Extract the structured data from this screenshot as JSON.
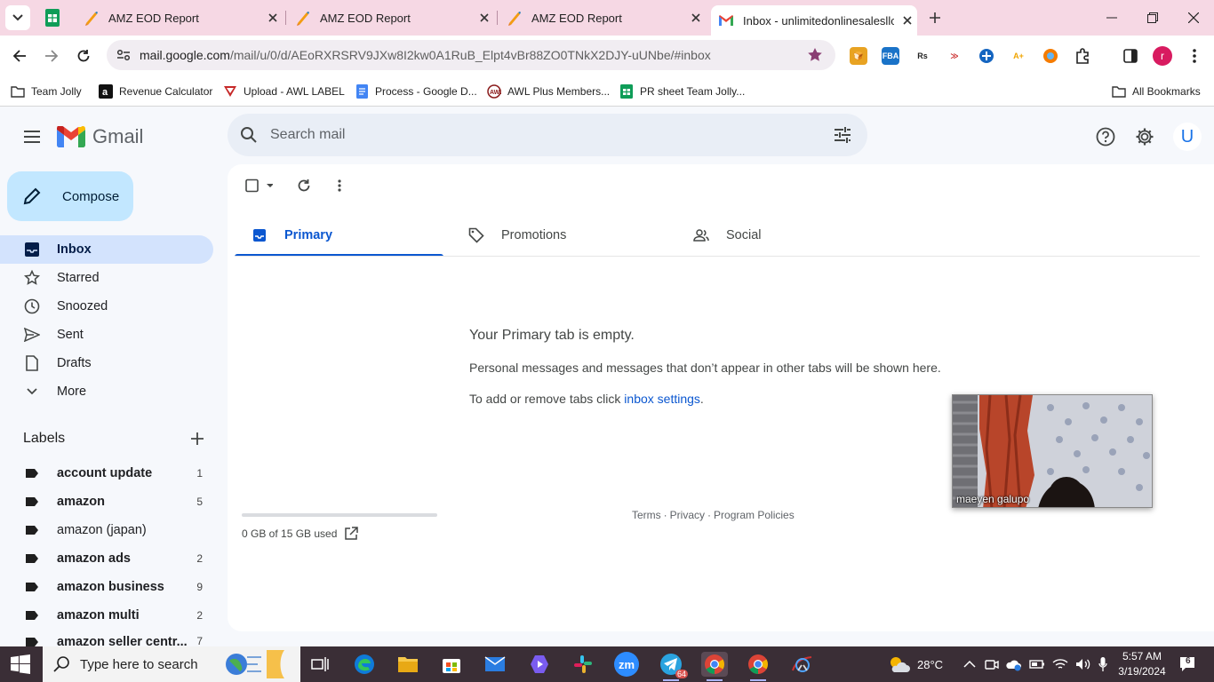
{
  "browser": {
    "tabs": [
      {
        "title": "AMZ EOD Report"
      },
      {
        "title": "AMZ EOD Report"
      },
      {
        "title": "AMZ EOD Report"
      },
      {
        "title": "Inbox - unlimitedonlinesalesllc@gmail.com - Gmail",
        "active": true
      }
    ],
    "url_host": "mail.google.com",
    "url_path": "/mail/u/0/d/AEoRXRSRV9JXw8I2kw0A1RuB_Elpt4vBr88ZO0TNkX2DJY-uUNbe/#inbox",
    "profile_initial": "r",
    "bookmarks": [
      {
        "label": "Team Jolly",
        "icon": "folder-icon"
      },
      {
        "label": "Revenue Calculator",
        "icon": "amazon-icon"
      },
      {
        "label": "Upload - AWL LABEL",
        "icon": "awl-icon"
      },
      {
        "label": "Process - Google D...",
        "icon": "docs-icon"
      },
      {
        "label": "AWL Plus Members...",
        "icon": "awl-plus-icon"
      },
      {
        "label": "PR sheet Team Jolly...",
        "icon": "sheets-icon"
      }
    ],
    "all_bookmarks_label": "All Bookmarks"
  },
  "gmail": {
    "logo_text": "Gmail",
    "search_placeholder": "Search mail",
    "avatar_initial": "U",
    "compose_label": "Compose",
    "nav": [
      {
        "label": "Inbox",
        "icon": "inbox-icon",
        "active": true
      },
      {
        "label": "Starred",
        "icon": "star-icon"
      },
      {
        "label": "Snoozed",
        "icon": "clock-icon"
      },
      {
        "label": "Sent",
        "icon": "send-icon"
      },
      {
        "label": "Drafts",
        "icon": "draft-icon"
      },
      {
        "label": "More",
        "icon": "chevron-down-icon"
      }
    ],
    "labels_heading": "Labels",
    "labels": [
      {
        "name": "account update",
        "count": "1",
        "bold": true
      },
      {
        "name": "amazon",
        "count": "5",
        "bold": true
      },
      {
        "name": "amazon (japan)",
        "count": "",
        "bold": false
      },
      {
        "name": "amazon ads",
        "count": "2",
        "bold": true
      },
      {
        "name": "amazon business",
        "count": "9",
        "bold": true
      },
      {
        "name": "amazon multi",
        "count": "2",
        "bold": true
      },
      {
        "name": "amazon seller centr...",
        "count": "7",
        "bold": true
      }
    ],
    "category_tabs": [
      {
        "label": "Primary",
        "icon": "inbox-tab-icon",
        "active": true
      },
      {
        "label": "Promotions",
        "icon": "tag-icon"
      },
      {
        "label": "Social",
        "icon": "people-icon"
      }
    ],
    "empty_state": {
      "title": "Your Primary tab is empty.",
      "description": "Personal messages and messages that don’t appear in other tabs will be shown here.",
      "hint_prefix": "To add or remove tabs click ",
      "hint_link": "inbox settings",
      "hint_suffix": "."
    },
    "storage": {
      "text": "0 GB of 15 GB used",
      "fraction": 0.0
    },
    "footer": {
      "terms": "Terms",
      "privacy": "Privacy",
      "policies": "Program Policies",
      "separator": "·"
    }
  },
  "video_overlay": {
    "participant_name": "maeyen galupo"
  },
  "taskbar": {
    "search_placeholder": "Type here to search",
    "weather": "28°C",
    "time": "5:57 AM",
    "date": "3/19/2024",
    "notification_count": "6",
    "telegram_badge": "64",
    "zoom_label": "zm"
  },
  "colors": {
    "tabstrip": "#f6d8e4",
    "accent_blue": "#0b57d0",
    "compose_bg": "#c2e7ff",
    "active_nav_bg": "#d3e3fd",
    "taskbar": "#3a2e36"
  }
}
